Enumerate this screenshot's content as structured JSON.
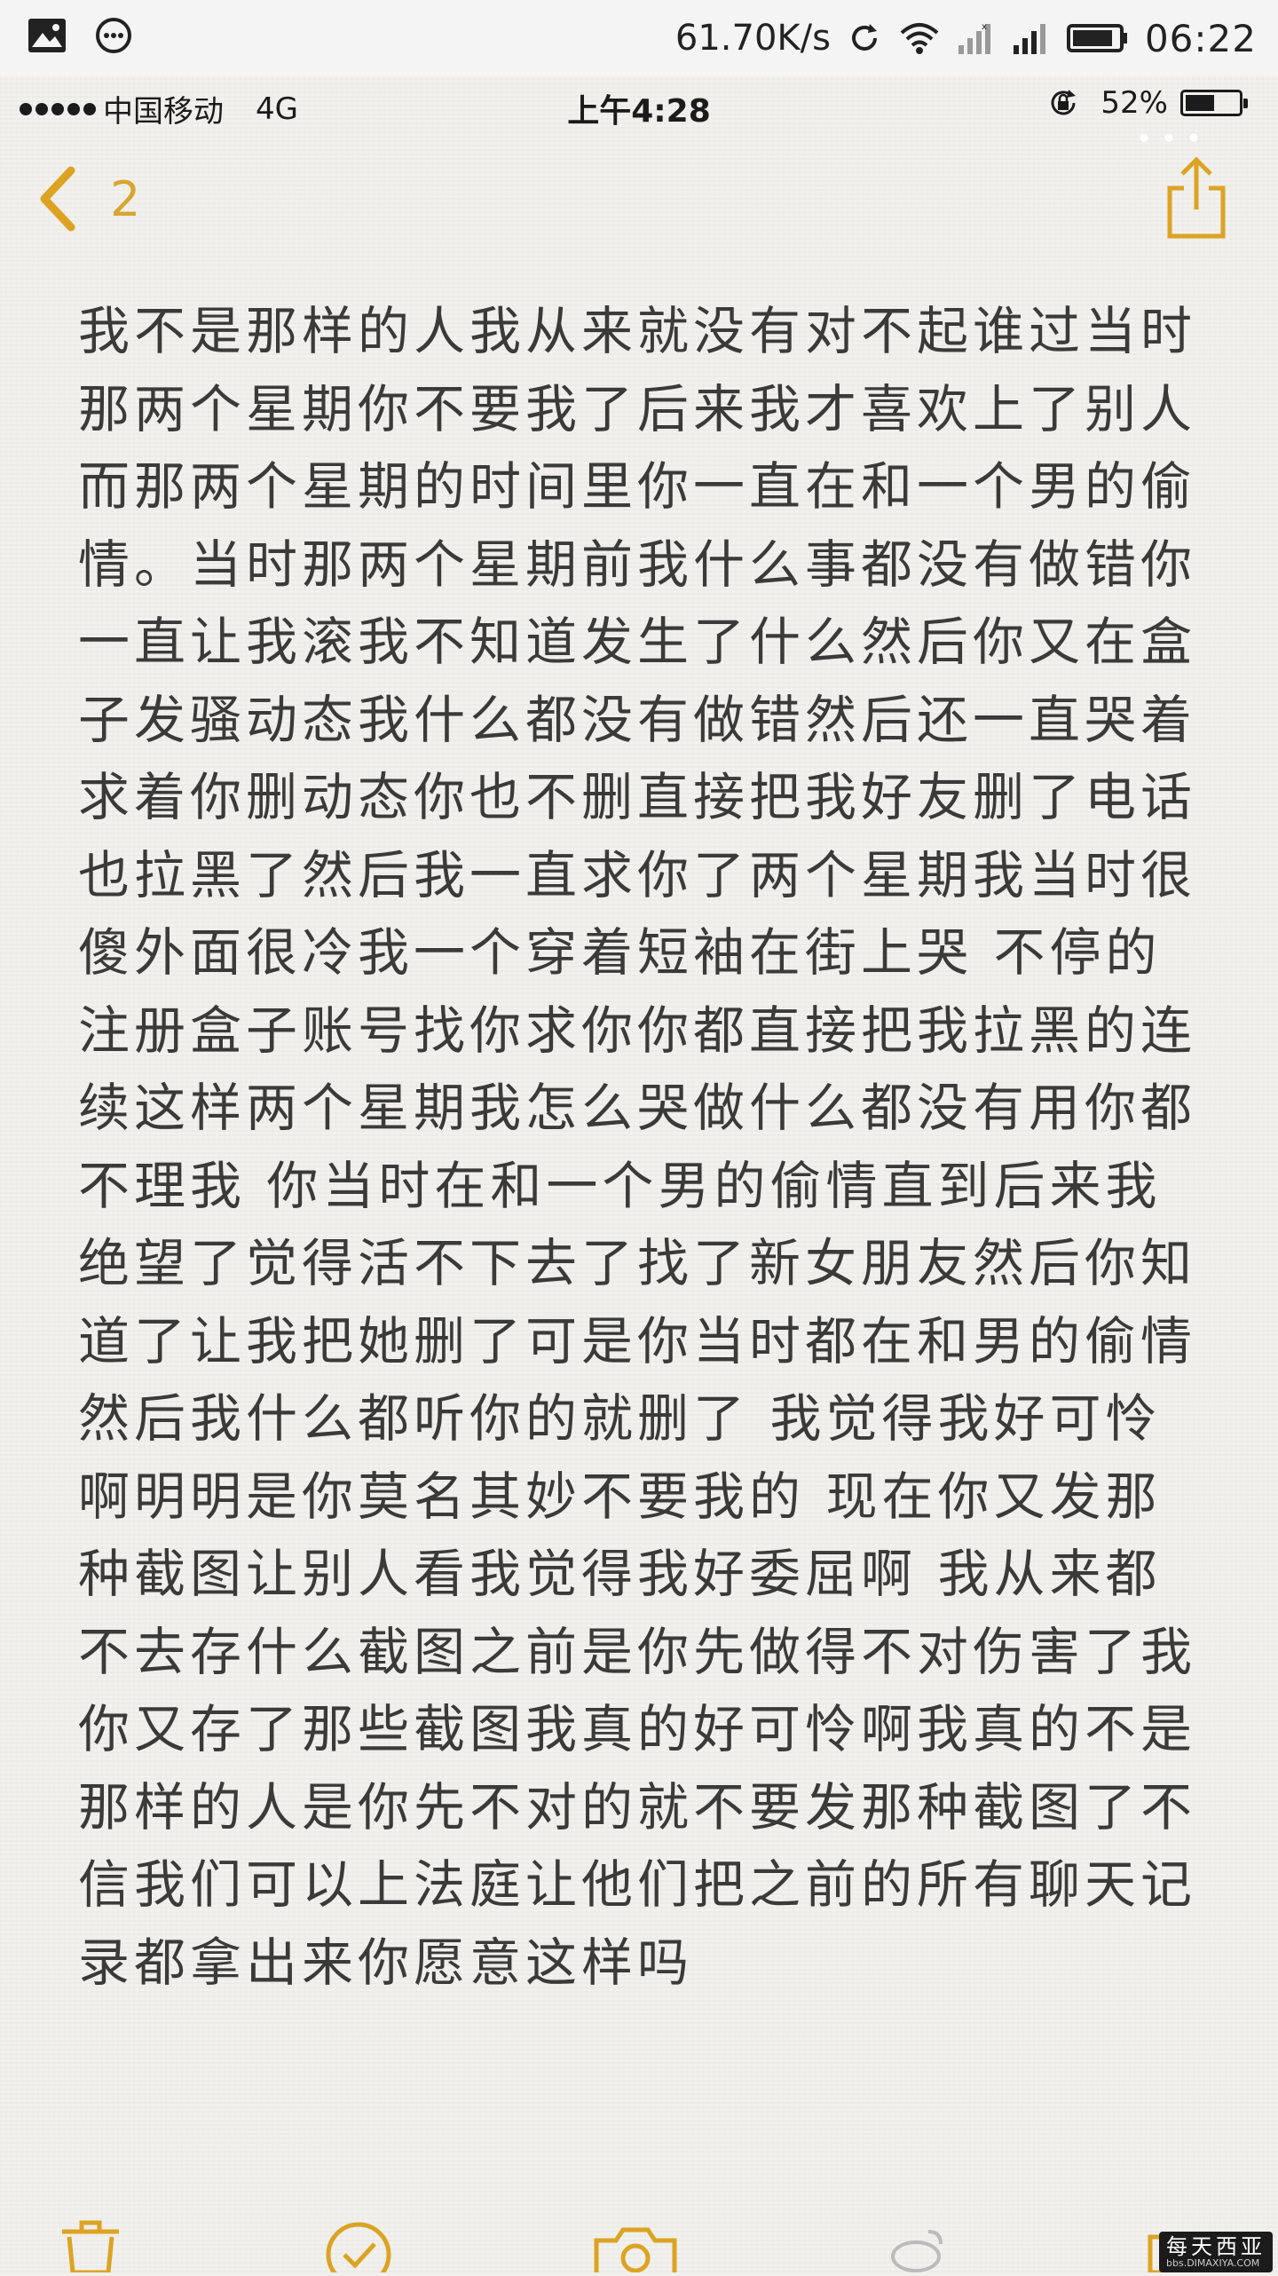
{
  "android_status": {
    "network_speed": "61.70K/s",
    "time": "06:22",
    "icons": [
      "image-icon",
      "message-icon",
      "sync-icon",
      "wifi-icon",
      "signal-icon",
      "signal-icon-2",
      "battery-icon"
    ]
  },
  "ios_status": {
    "carrier": "中国移动",
    "network": "4G",
    "time": "上午4:28",
    "battery": "52%",
    "battery_level": 0.52
  },
  "nav": {
    "back_count": "2",
    "back_icon": "chevron-left-icon",
    "share_icon": "share-icon"
  },
  "note": {
    "text": "我不是那样的人我从来就没有对不起谁过当时那两个星期你不要我了后来我才喜欢上了别人而那两个星期的时间里你一直在和一个男的偷情。当时那两个星期前我什么事都没有做错你一直让我滚我不知道发生了什么然后你又在盒子发骚动态我什么都没有做错然后还一直哭着求着你删动态你也不删直接把我好友删了电话也拉黑了然后我一直求你了两个星期我当时很傻外面很冷我一个穿着短袖在街上哭 不停的注册盒子账号找你求你你都直接把我拉黑的连续这样两个星期我怎么哭做什么都没有用你都不理我 你当时在和一个男的偷情直到后来我绝望了觉得活不下去了找了新女朋友然后你知道了让我把她删了可是你当时都在和男的偷情然后我什么都听你的就删了 我觉得我好可怜啊明明是你莫名其妙不要我的 现在你又发那种截图让别人看我觉得我好委屈啊 我从来都不去存什么截图之前是你先做得不对伤害了我你又存了那些截图我真的好可怜啊我真的不是那样的人是你先不对的就不要发那种截图了不信我们可以上法庭让他们把之前的所有聊天记录都拿出来你愿意这样吗"
  },
  "toolbar": {
    "icons": [
      "trash-icon",
      "checklist-icon",
      "camera-icon",
      "compose-icon"
    ]
  },
  "watermark": {
    "line1": "每天西亚",
    "line2": "bbs.DIMAXIYA.COM"
  },
  "colors": {
    "accent": "#dca323",
    "text": "#3a3a38",
    "paper": "#f2f1ed"
  }
}
